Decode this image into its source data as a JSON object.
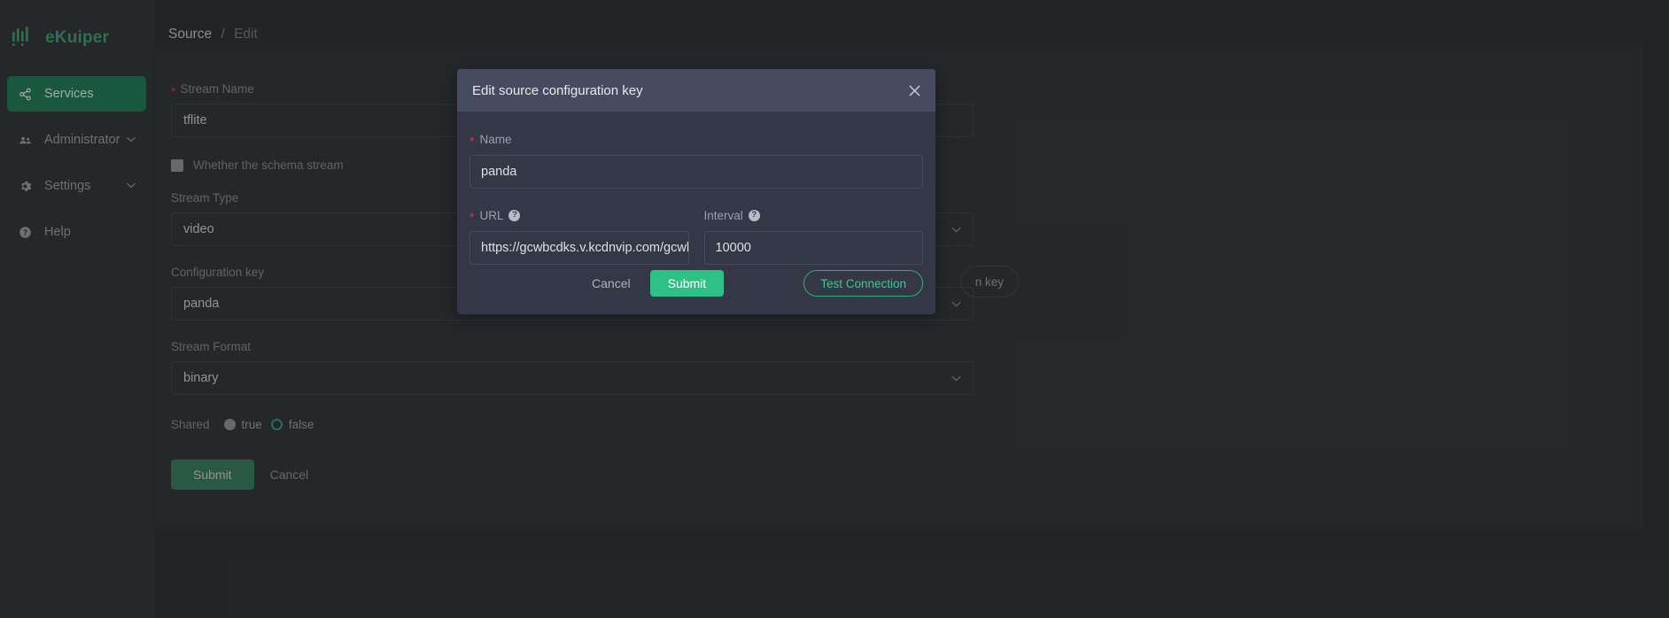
{
  "sidebar": {
    "brand": "eKuiper",
    "items": [
      {
        "label": "Services",
        "icon": "share-icon",
        "active": true,
        "caret": ""
      },
      {
        "label": "Administrator",
        "icon": "users-icon",
        "active": false,
        "caret": "⌄"
      },
      {
        "label": "Settings",
        "icon": "gear-icon",
        "active": false,
        "caret": "⌄"
      },
      {
        "label": "Help",
        "icon": "question-circle-icon",
        "active": false,
        "caret": ""
      }
    ]
  },
  "breadcrumb": {
    "root": "Source",
    "separator": "/",
    "current": "Edit"
  },
  "form": {
    "stream_name": {
      "label": "Stream Name",
      "required": true,
      "value": "tflite"
    },
    "schema_checkbox": {
      "label": "Whether the schema stream",
      "checked": false
    },
    "stream_type": {
      "label": "Stream Type",
      "value": "video"
    },
    "configuration_key": {
      "label": "Configuration key",
      "value": "panda",
      "side_button": "n key"
    },
    "stream_format": {
      "label": "Stream Format",
      "value": "binary"
    },
    "shared": {
      "label": "Shared",
      "options": [
        "true",
        "false"
      ],
      "selected": "false"
    },
    "submit_label": "Submit",
    "cancel_label": "Cancel"
  },
  "modal": {
    "title": "Edit source configuration key",
    "close_icon": "close-icon",
    "name": {
      "label": "Name",
      "required": true,
      "value": "panda"
    },
    "url": {
      "label": "URL",
      "required": true,
      "value": "https://gcwbcdks.v.kcdnvip.com/gcwbc",
      "help_icon": "question-circle-icon"
    },
    "interval": {
      "label": "Interval",
      "required": false,
      "value": "10000",
      "help_icon": "question-circle-icon"
    },
    "cancel_label": "Cancel",
    "submit_label": "Submit",
    "test_label": "Test Connection"
  },
  "colors": {
    "accent_green": "#2dc185",
    "brand_green": "#3a9e6e",
    "nav_active": "#1d7a51",
    "required_red": "#b5485d",
    "modal_bg": "#343746",
    "modal_header": "#474b5f"
  }
}
